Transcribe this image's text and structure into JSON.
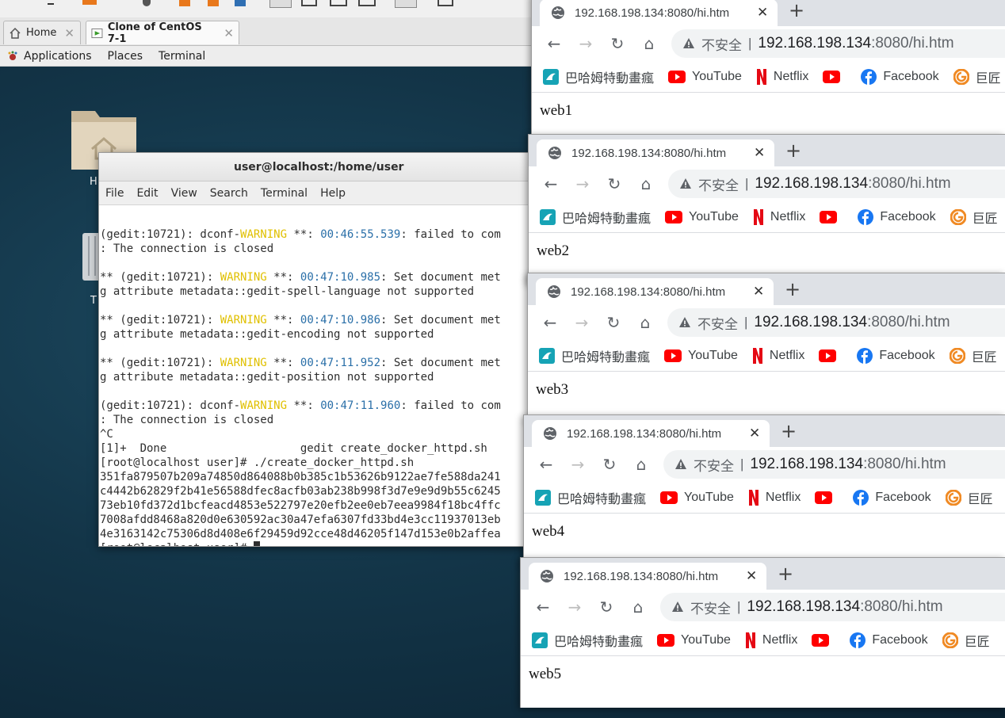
{
  "vm": {
    "tabs": [
      {
        "label": "Home",
        "icon": "home-icon"
      },
      {
        "label": "Clone of CentOS 7-1",
        "icon": "vm-icon"
      }
    ]
  },
  "gnome": {
    "applications": "Applications",
    "places": "Places",
    "terminal": "Terminal"
  },
  "desktop": {
    "icons": [
      {
        "label": "H",
        "icon": "home-folder-icon"
      },
      {
        "label": "T",
        "icon": "trash-icon"
      }
    ]
  },
  "terminal": {
    "title": "user@localhost:/home/user",
    "menu": [
      "File",
      "Edit",
      "View",
      "Search",
      "Terminal",
      "Help"
    ],
    "lines": [
      [
        {
          "t": ""
        }
      ],
      [
        {
          "t": "(gedit:10721): dconf-"
        },
        {
          "t": "WARNING",
          "c": "warn"
        },
        {
          "t": " **: "
        },
        {
          "t": "00:46:55.539",
          "c": "ts"
        },
        {
          "t": ": failed to com"
        }
      ],
      [
        {
          "t": ": The connection is closed"
        }
      ],
      [
        {
          "t": ""
        }
      ],
      [
        {
          "t": "** (gedit:10721): "
        },
        {
          "t": "WARNING",
          "c": "warn"
        },
        {
          "t": " **: "
        },
        {
          "t": "00:47:10.985",
          "c": "ts"
        },
        {
          "t": ": Set document met"
        }
      ],
      [
        {
          "t": "g attribute metadata::gedit-spell-language not supported"
        }
      ],
      [
        {
          "t": ""
        }
      ],
      [
        {
          "t": "** (gedit:10721): "
        },
        {
          "t": "WARNING",
          "c": "warn"
        },
        {
          "t": " **: "
        },
        {
          "t": "00:47:10.986",
          "c": "ts"
        },
        {
          "t": ": Set document met"
        }
      ],
      [
        {
          "t": "g attribute metadata::gedit-encoding not supported"
        }
      ],
      [
        {
          "t": ""
        }
      ],
      [
        {
          "t": "** (gedit:10721): "
        },
        {
          "t": "WARNING",
          "c": "warn"
        },
        {
          "t": " **: "
        },
        {
          "t": "00:47:11.952",
          "c": "ts"
        },
        {
          "t": ": Set document met"
        }
      ],
      [
        {
          "t": "g attribute metadata::gedit-position not supported"
        }
      ],
      [
        {
          "t": ""
        }
      ],
      [
        {
          "t": "(gedit:10721): dconf-"
        },
        {
          "t": "WARNING",
          "c": "warn"
        },
        {
          "t": " **: "
        },
        {
          "t": "00:47:11.960",
          "c": "ts"
        },
        {
          "t": ": failed to com"
        }
      ],
      [
        {
          "t": ": The connection is closed"
        }
      ],
      [
        {
          "t": "^C"
        }
      ],
      [
        {
          "t": "[1]+  Done                    gedit create_docker_httpd.sh"
        }
      ],
      [
        {
          "t": "[root@localhost user]# ./create_docker_httpd.sh"
        }
      ],
      [
        {
          "t": "351fa879507b209a74850d864088b0b385c1b53626b9122ae7fe588da241"
        }
      ],
      [
        {
          "t": "c4442b62829f2b41e56588dfec8acfb03ab238b998f3d7e9e9d9b55c6245"
        }
      ],
      [
        {
          "t": "73eb10fd372d1bcfeacd4853e522797e20efb2ee0eb7eea9984f18bc4ffc"
        }
      ],
      [
        {
          "t": "7008afdd8468a820d0e630592ac30a47efa6307fd33bd4e3cc11937013eb"
        }
      ],
      [
        {
          "t": "4e3163142c75306d8d408e6f29459d92cce48d46205f147d153e0b2affea"
        }
      ],
      [
        {
          "t": "[root@localhost user]# "
        }
      ]
    ]
  },
  "browsers": [
    {
      "tab_title": "192.168.198.134:8080/hi.htm",
      "secure_label": "不安全",
      "sep": "|",
      "host": "192.168.198.134",
      "path": ":8080/hi.htm",
      "content": "web1"
    },
    {
      "tab_title": "192.168.198.134:8080/hi.htm",
      "secure_label": "不安全",
      "sep": "|",
      "host": "192.168.198.134",
      "path": ":8080/hi.htm",
      "content": "web2"
    },
    {
      "tab_title": "192.168.198.134:8080/hi.htm",
      "secure_label": "不安全",
      "sep": "|",
      "host": "192.168.198.134",
      "path": ":8080/hi.htm",
      "content": "web3"
    },
    {
      "tab_title": "192.168.198.134:8080/hi.htm",
      "secure_label": "不安全",
      "sep": "|",
      "host": "192.168.198.134",
      "path": ":8080/hi.htm",
      "content": "web4"
    },
    {
      "tab_title": "192.168.198.134:8080/hi.htm",
      "secure_label": "不安全",
      "sep": "|",
      "host": "192.168.198.134",
      "path": ":8080/hi.htm",
      "content": "web5"
    }
  ],
  "bookmarks": [
    {
      "label": "巴哈姆特動畫瘋",
      "icon": "bahamut-icon"
    },
    {
      "label": "YouTube",
      "icon": "youtube-icon"
    },
    {
      "label": "Netflix",
      "icon": "netflix-icon"
    },
    {
      "label": "",
      "icon": "youtube-icon"
    },
    {
      "label": "Facebook",
      "icon": "facebook-icon"
    },
    {
      "label": "巨匠",
      "icon": "giant-icon"
    }
  ],
  "colors": {
    "warn": "#e0c000",
    "timestamp": "#2a6fa8",
    "youtube": "#ff0000",
    "netflix": "#e50914",
    "facebook": "#1877f2"
  }
}
